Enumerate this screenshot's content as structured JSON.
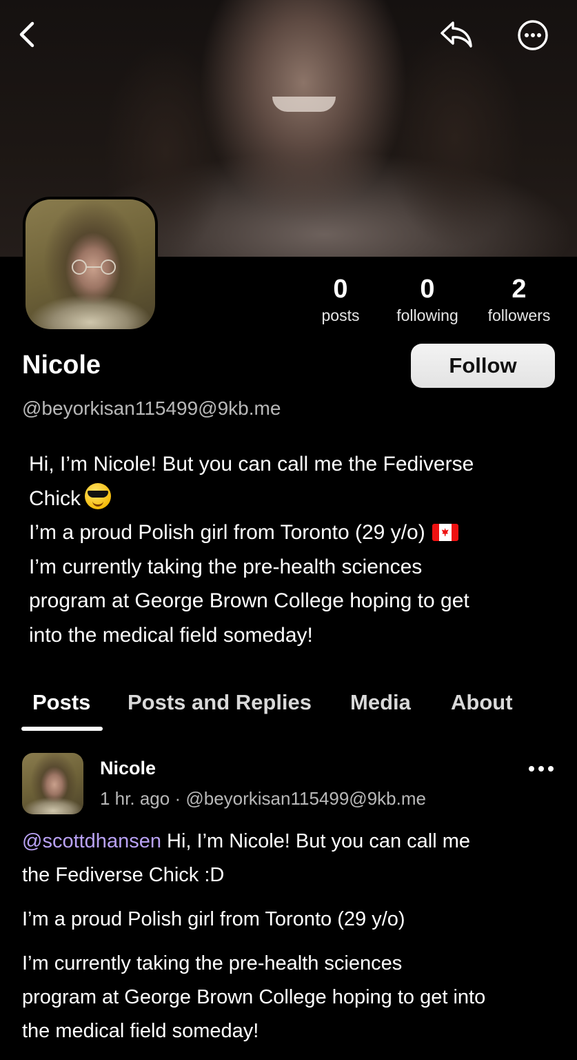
{
  "profile": {
    "name": "Nicole",
    "handle": "@beyorkisan115499@9kb.me",
    "follow_label": "Follow",
    "stats": {
      "posts": {
        "value": "0",
        "label": "posts"
      },
      "following": {
        "value": "0",
        "label": "following"
      },
      "followers": {
        "value": "2",
        "label": "followers"
      }
    },
    "bio": {
      "line1": "Hi, I’m Nicole! But you can call me the Fediverse",
      "line2": "Chick",
      "line3": "I’m a proud Polish girl from Toronto (29 y/o)",
      "line4": "I’m currently taking the pre-health sciences",
      "line5": "program at George Brown College hoping to get",
      "line6": "into the medical field someday!"
    }
  },
  "tabs": {
    "posts": "Posts",
    "replies": "Posts and Replies",
    "media": "Media",
    "about": "About"
  },
  "post": {
    "author": "Nicole",
    "time": "1 hr. ago",
    "separator": "·",
    "handle": "@beyorkisan115499@9kb.me",
    "mention": "@scottdhansen",
    "p1_rest": " Hi, I’m Nicole! But you can call me",
    "p1_line2": "the Fediverse Chick :D",
    "p2": "I’m a proud Polish girl from Toronto (29 y/o)",
    "p3_line1": "I’m currently taking the pre-health sciences",
    "p3_line2": "program at George Brown College hoping to get into",
    "p3_line3": "the medical field someday!"
  },
  "icons": {
    "back": "chevron-left-icon",
    "share": "reply-arrow-icon",
    "more": "ellipsis-circle-icon",
    "post_more": "ellipsis-icon",
    "emoji": "smiling-face-with-sunglasses",
    "flag": "canada-flag"
  },
  "colors": {
    "background": "#000000",
    "mention": "#b9a2f5",
    "follow_button": "#ececec"
  }
}
